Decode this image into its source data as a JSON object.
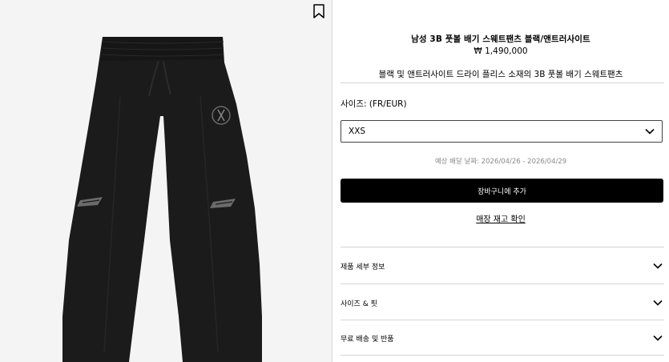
{
  "product": {
    "title": "남성 3B 풋볼 배기 스웨트팬츠 블랙/앤트러사이트",
    "price": "₩ 1,490,000",
    "description": "블랙 및 앤트러사이트 드라이 플리스 소재의 3B 풋볼 배기 스웨트팬츠"
  },
  "size": {
    "label": "사이즈: (FR/EUR)",
    "selected": "XXS"
  },
  "delivery_text": "예상 배달 날짜: 2026/04/26 - 2026/04/29",
  "actions": {
    "add_to_cart": "장바구니에 추가",
    "store_stock": "매장 재고 확인"
  },
  "accordions": [
    {
      "label": "제품 세부 정보"
    },
    {
      "label": "사이즈 & 핏"
    },
    {
      "label": "무료 배송 및 반품"
    }
  ],
  "icons": {
    "wishlist": "bookmark-icon",
    "dropdown": "chevron-down-icon"
  },
  "colors": {
    "accent": "#000000",
    "gallery_bg": "#f4f4f4",
    "muted_text": "#8a8a8a"
  }
}
